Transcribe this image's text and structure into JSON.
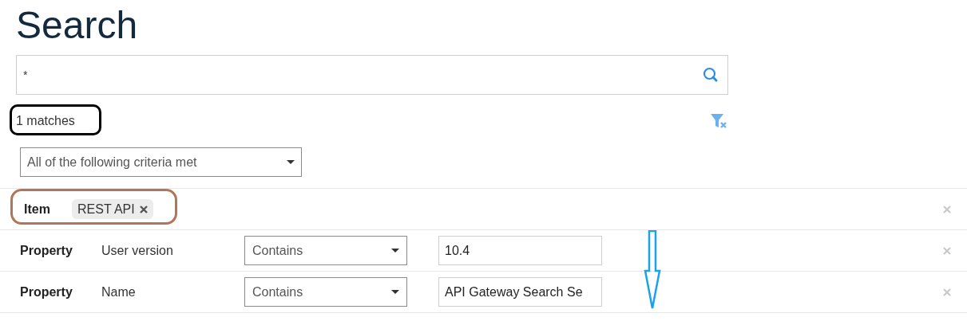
{
  "title": "Search",
  "search": {
    "value": "*"
  },
  "match_count": "1 matches",
  "criteria_mode": "All of the following criteria met",
  "criteria": [
    {
      "kind": "item",
      "label": "Item",
      "tags": [
        "REST API"
      ]
    },
    {
      "kind": "property",
      "label": "Property",
      "field": "User version",
      "operator": "Contains",
      "value": "10.4"
    },
    {
      "kind": "property",
      "label": "Property",
      "field": "Name",
      "operator": "Contains",
      "value": "API Gateway Search Se"
    }
  ]
}
